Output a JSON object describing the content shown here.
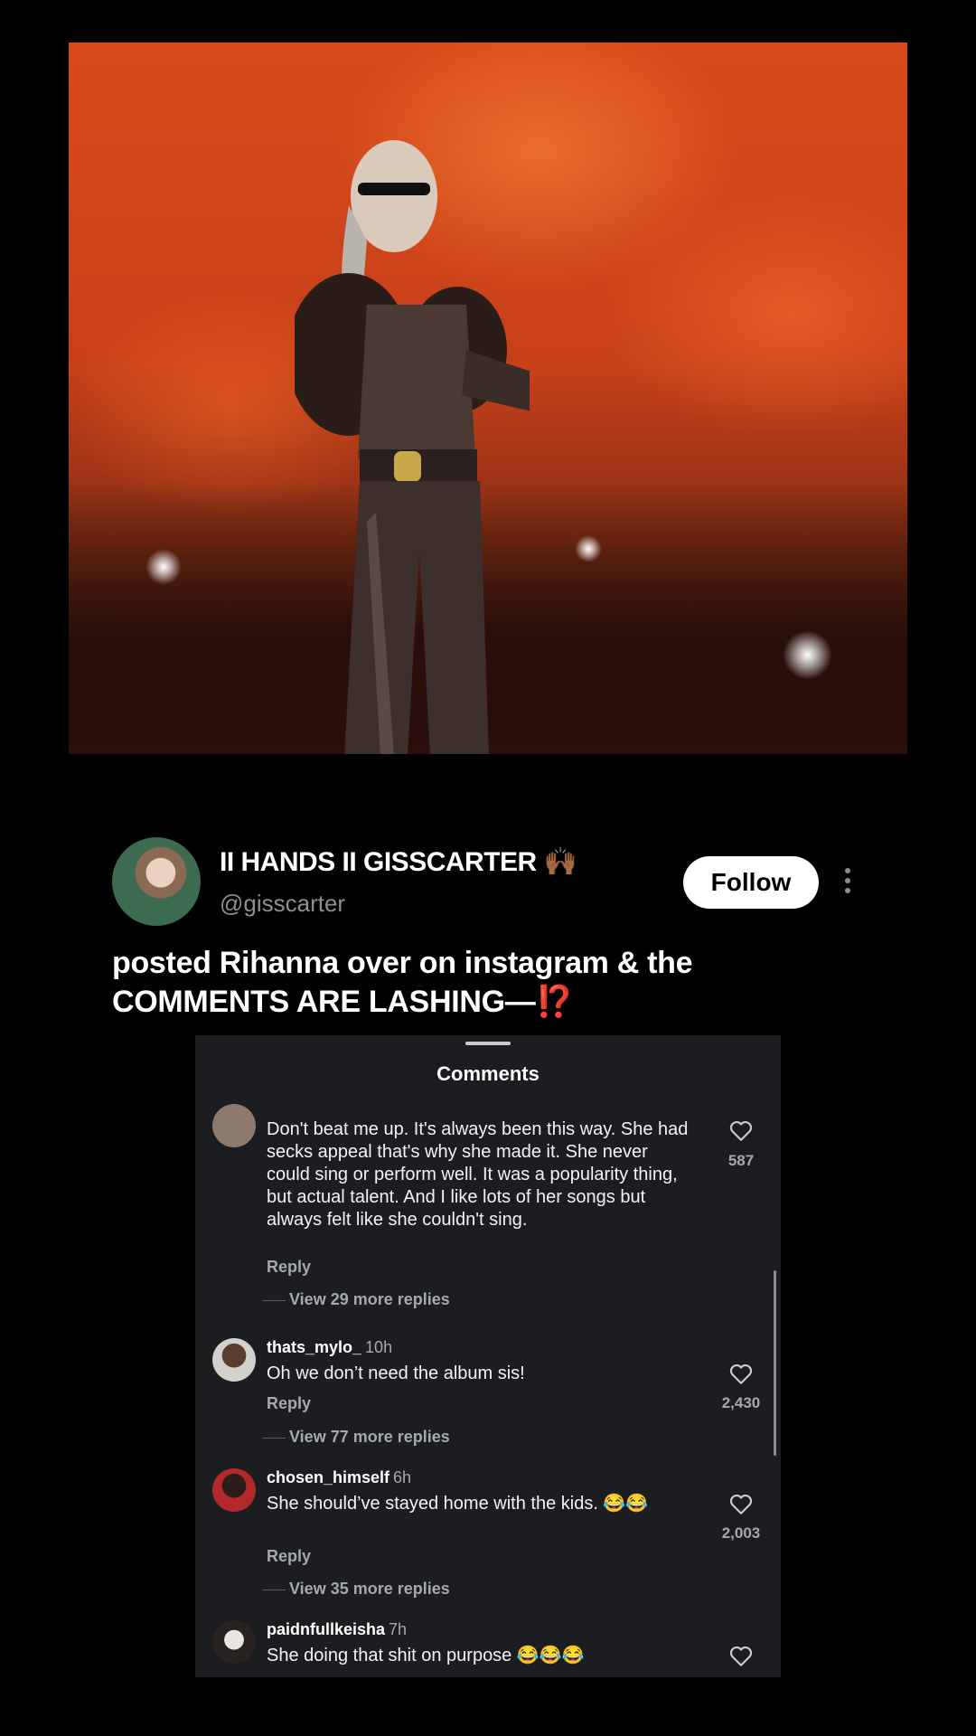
{
  "post": {
    "author_name": "II HANDS II GISSCARTER 🙌🏾",
    "author_handle": "@gisscarter",
    "follow_label": "Follow",
    "caption_line1": "posted Rihanna over on instagram & the",
    "caption_line2": "COMMENTS ARE LASHING—",
    "caption_emoji": "⁉️"
  },
  "comments_panel": {
    "title": "Comments",
    "items": [
      {
        "user": "",
        "time": "",
        "text": "Don't beat me up.  It's always been this way. She had secks appeal that's why she made it. She never could sing or perform well. It was a popularity thing, but actual talent. And I like lots of her songs but always felt like she couldn't sing.",
        "reply_label": "Reply",
        "more_replies": "View 29 more replies",
        "likes": "587"
      },
      {
        "user": "thats_mylo_",
        "time": "10h",
        "text": "Oh we don’t need the album sis!",
        "reply_label": "Reply",
        "more_replies": "View 77 more replies",
        "likes": "2,430"
      },
      {
        "user": "chosen_himself",
        "time": "6h",
        "text": "She should’ve stayed home with the kids. 😂😂",
        "reply_label": "Reply",
        "more_replies": "View 35 more replies",
        "likes": "2,003"
      },
      {
        "user": "paidnfullkeisha",
        "time": "7h",
        "text": "She doing that shit on purpose 😂😂😂",
        "reply_label": "",
        "more_replies": "",
        "likes": ""
      }
    ]
  },
  "icons": {
    "heart": "heart-icon",
    "more": "more-vertical-icon"
  },
  "colors": {
    "background": "#000000",
    "panel": "#1b1d20",
    "muted": "#8b8f94",
    "alert": "#e0453a"
  }
}
